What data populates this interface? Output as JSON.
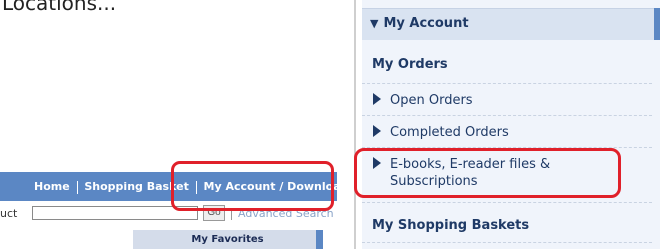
{
  "left_page": {
    "caption_partial": "Locations...",
    "top_nav": {
      "items": [
        {
          "label": "Home"
        },
        {
          "label": "Shopping Basket"
        },
        {
          "label": "My Account / Downloads"
        }
      ]
    },
    "search": {
      "label_partial": "uct",
      "input_value": "",
      "go_label": "Go",
      "advanced_label": "Advanced Search"
    },
    "favorites_label": "My Favorites"
  },
  "account_menu": {
    "header": "My Account",
    "sections": [
      {
        "title": "My Orders",
        "items": [
          {
            "label": "Open Orders"
          },
          {
            "label": "Completed Orders"
          },
          {
            "label": "E-books, E-reader files & Subscriptions"
          }
        ]
      },
      {
        "title": "My Shopping Baskets",
        "items": []
      }
    ]
  },
  "colors": {
    "nav_blue": "#5b87c4",
    "panel_bg": "#f0f4fb",
    "text_dark_blue": "#1f3a66",
    "highlight_red": "#e0202a"
  }
}
